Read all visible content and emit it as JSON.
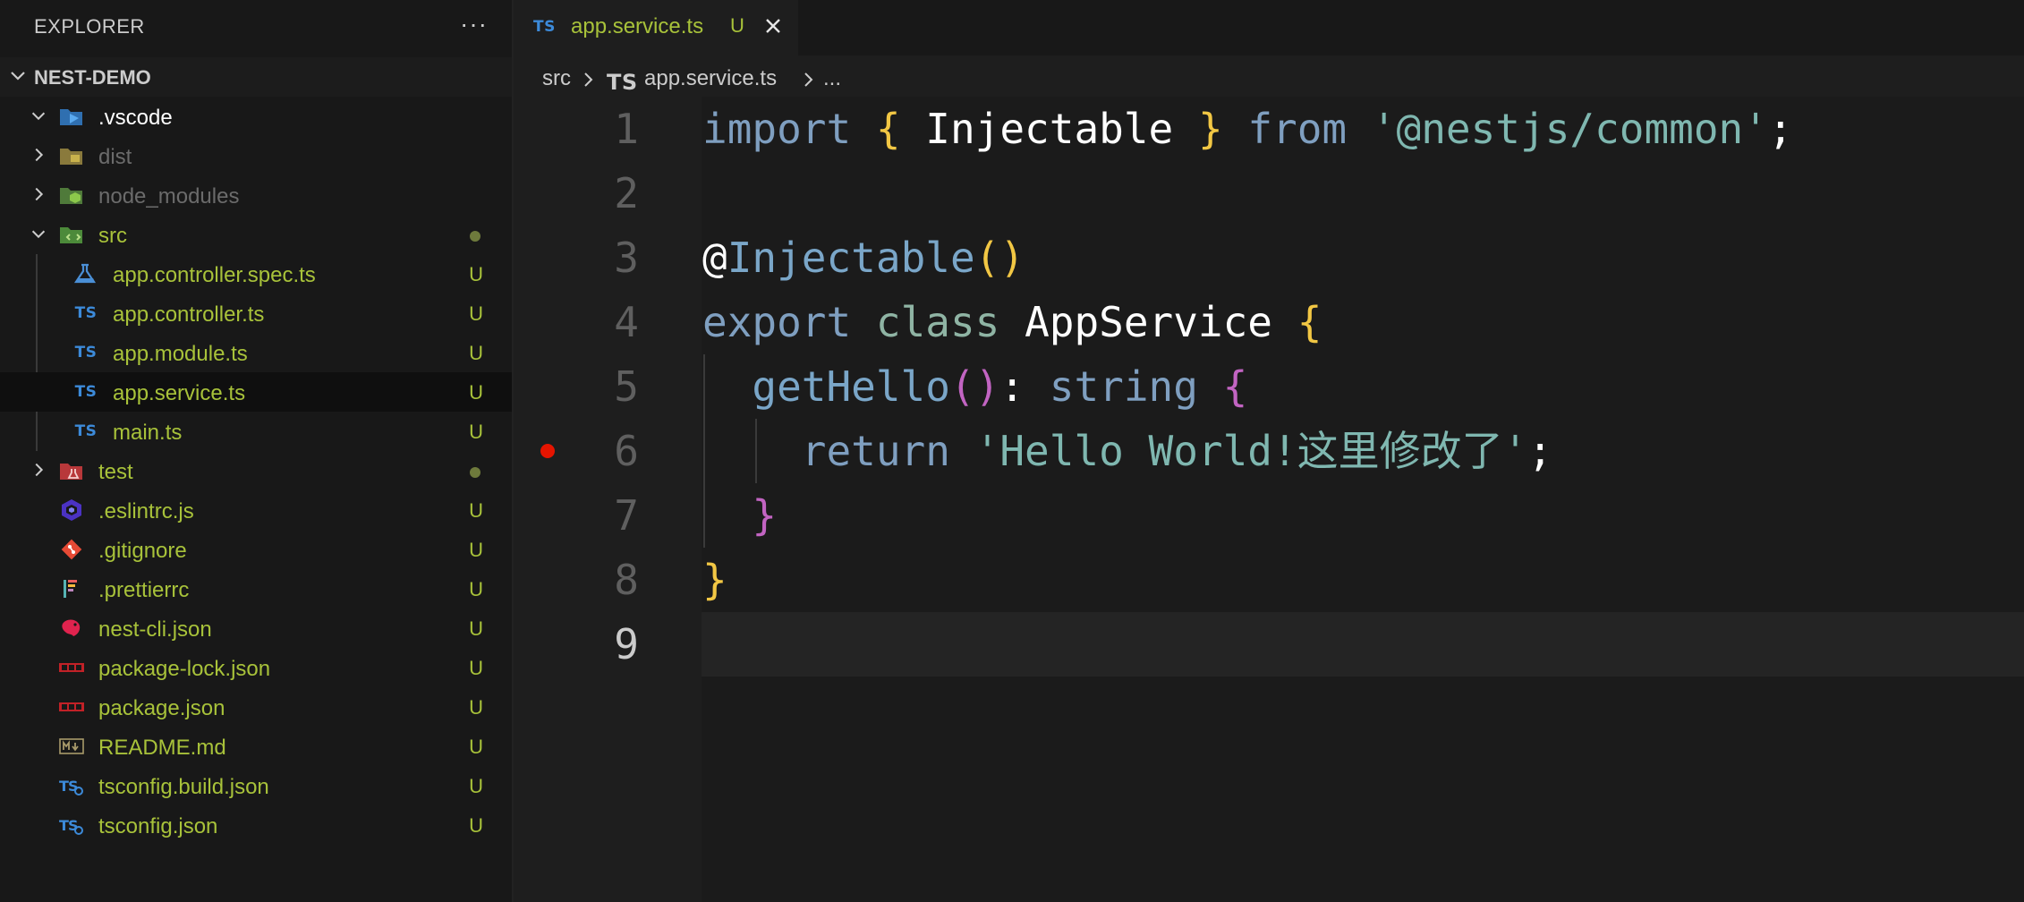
{
  "sidebar": {
    "title": "EXPLORER",
    "more_icon": "ellipsis-icon",
    "project_name": "NEST-DEMO",
    "items": [
      {
        "label": ".vscode",
        "icon": "vscode-folder-icon",
        "color": "#ffffff",
        "status": "",
        "expanded": true
      },
      {
        "label": "dist",
        "icon": "dist-folder-icon",
        "color": "#6b6b6b",
        "status": ""
      },
      {
        "label": "node_modules",
        "icon": "node-folder-icon",
        "color": "#6b6b6b",
        "status": ""
      },
      {
        "label": "src",
        "icon": "src-folder-icon",
        "color": "#a8c23a",
        "status": "dot",
        "expanded": true
      },
      {
        "label": "app.controller.spec.ts",
        "icon": "test-flask-icon",
        "color": "#a8c23a",
        "status": "U"
      },
      {
        "label": "app.controller.ts",
        "icon": "typescript-icon",
        "color": "#a8c23a",
        "status": "U"
      },
      {
        "label": "app.module.ts",
        "icon": "typescript-icon",
        "color": "#a8c23a",
        "status": "U"
      },
      {
        "label": "app.service.ts",
        "icon": "typescript-icon",
        "color": "#a8c23a",
        "status": "U",
        "selected": true
      },
      {
        "label": "main.ts",
        "icon": "typescript-icon",
        "color": "#a8c23a",
        "status": "U"
      },
      {
        "label": "test",
        "icon": "test-folder-icon",
        "color": "#a8c23a",
        "status": "dot"
      },
      {
        "label": ".eslintrc.js",
        "icon": "eslint-icon",
        "color": "#a8c23a",
        "status": "U"
      },
      {
        "label": ".gitignore",
        "icon": "git-icon",
        "color": "#a8c23a",
        "status": "U"
      },
      {
        "label": ".prettierrc",
        "icon": "prettier-icon",
        "color": "#a8c23a",
        "status": "U"
      },
      {
        "label": "nest-cli.json",
        "icon": "nestjs-icon",
        "color": "#a8c23a",
        "status": "U"
      },
      {
        "label": "package-lock.json",
        "icon": "npm-icon",
        "color": "#a8c23a",
        "status": "U"
      },
      {
        "label": "package.json",
        "icon": "npm-icon",
        "color": "#a8c23a",
        "status": "U"
      },
      {
        "label": "README.md",
        "icon": "markdown-icon",
        "color": "#a8c23a",
        "status": "U"
      },
      {
        "label": "tsconfig.build.json",
        "icon": "tsconfig-icon",
        "color": "#a8c23a",
        "status": "U"
      },
      {
        "label": "tsconfig.json",
        "icon": "tsconfig-icon",
        "color": "#a8c23a",
        "status": "U"
      }
    ]
  },
  "ts_badge": "TS",
  "editor": {
    "tab": {
      "title": "app.service.ts",
      "status": "U",
      "close_icon": "close-icon"
    },
    "breadcrumb": {
      "folder": "src",
      "file": "app.service.ts",
      "ellipsis": "..."
    },
    "line_numbers": [
      "1",
      "2",
      "3",
      "4",
      "5",
      "6",
      "7",
      "8",
      "9"
    ],
    "active_line": 9,
    "breakpoint_line": 6,
    "code": {
      "l1": {
        "import": "import",
        "ob": "{",
        "name": "Injectable",
        "cb": "}",
        "from": "from",
        "module": "'@nestjs/common'",
        "semi": ";"
      },
      "l3": {
        "at": "@",
        "decorator": "Injectable",
        "parens": "()"
      },
      "l4": {
        "export": "export",
        "class": "class",
        "name": "AppService",
        "ob": "{"
      },
      "l5": {
        "method": "getHello",
        "parens": "()",
        "colon": ":",
        "type": "string",
        "ob": "{"
      },
      "l6": {
        "return": "return",
        "str": "'Hello World!这里修改了'",
        "semi": ";"
      },
      "l7": {
        "cb": "}"
      },
      "l8": {
        "cb": "}"
      }
    }
  },
  "colors": {
    "modified": "#a8c23a",
    "breakpoint": "#e51400",
    "ts_blue": "#3c8ad9"
  }
}
